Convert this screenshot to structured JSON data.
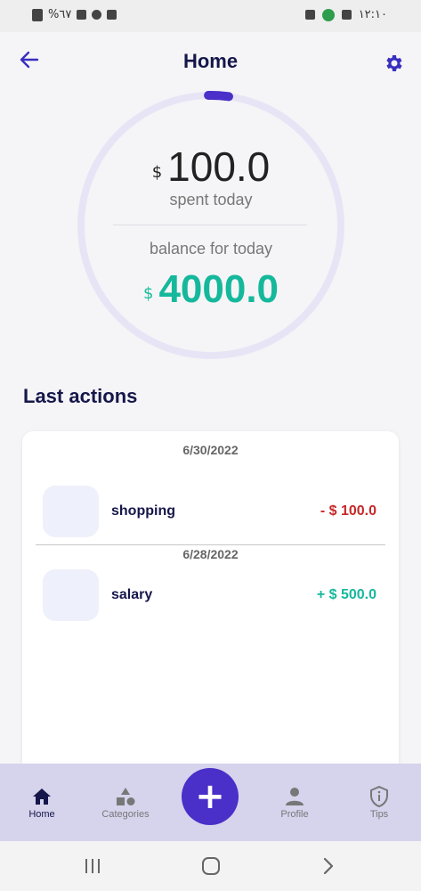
{
  "status_bar": {
    "left_text": "%٦٧",
    "time": "١٢:١٠"
  },
  "header": {
    "title": "Home",
    "back_icon": "arrow-left-icon",
    "settings_icon": "gear-icon"
  },
  "summary": {
    "currency": "$",
    "spent_amount": "100.0",
    "spent_label": "spent today",
    "balance_label": "balance for today",
    "balance_amount": "4000.0",
    "progress_fraction": 0.025,
    "colors": {
      "track": "#e7e5f5",
      "progress": "#4a2fc9",
      "balance": "#16b89c"
    }
  },
  "last_actions": {
    "title": "Last actions",
    "groups": [
      {
        "date": "6/30/2022",
        "items": [
          {
            "name": "shopping",
            "amount": "- $ 100.0",
            "type": "expense"
          }
        ]
      },
      {
        "date": "6/28/2022",
        "items": [
          {
            "name": "salary",
            "amount": "+ $ 500.0",
            "type": "income"
          }
        ]
      }
    ]
  },
  "bottom_nav": {
    "items": [
      {
        "label": "Home",
        "icon": "home-icon",
        "active": true
      },
      {
        "label": "Categories",
        "icon": "categories-icon",
        "active": false
      },
      {
        "label": "Profile",
        "icon": "profile-icon",
        "active": false
      },
      {
        "label": "Tips",
        "icon": "shield-info-icon",
        "active": false
      }
    ],
    "fab_label": "+",
    "fab_color": "#4a2fc9"
  },
  "system_nav": {
    "items": [
      "recent-apps-icon",
      "home-circle-icon",
      "back-chevron-icon"
    ]
  }
}
